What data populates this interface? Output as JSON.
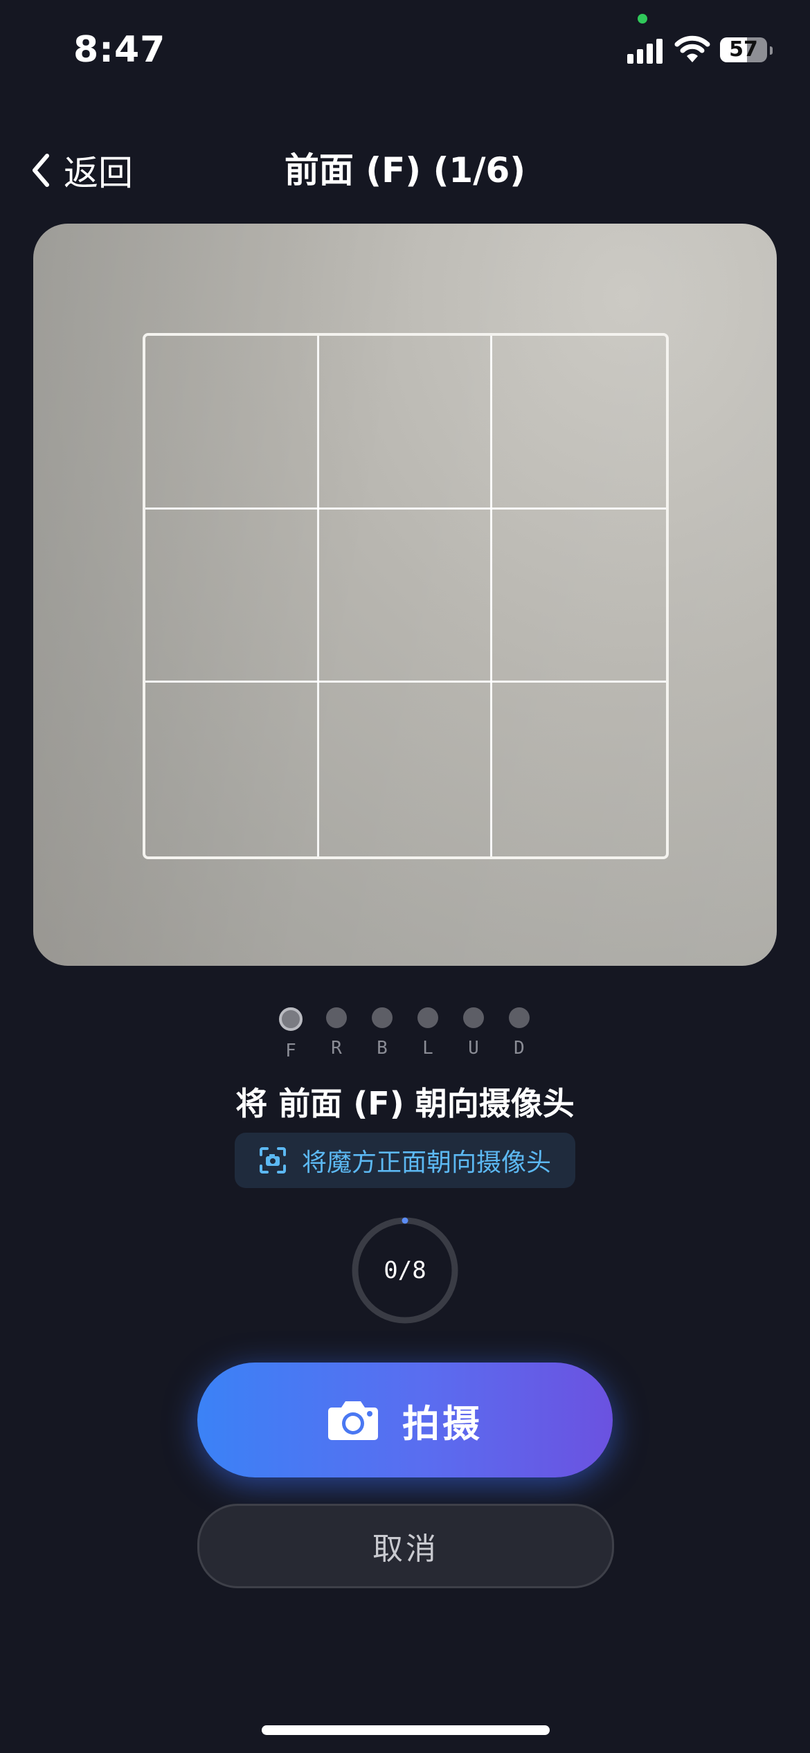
{
  "status_bar": {
    "time": "8:47",
    "battery_level": "57",
    "camera_indicator_color": "#30c85a"
  },
  "nav": {
    "back_label": "返回",
    "title": "前面 (F) (1/6)"
  },
  "scanner": {
    "grid": "3x3",
    "faces": [
      {
        "label": "F",
        "active": true
      },
      {
        "label": "R",
        "active": false
      },
      {
        "label": "B",
        "active": false
      },
      {
        "label": "L",
        "active": false
      },
      {
        "label": "U",
        "active": false
      },
      {
        "label": "D",
        "active": false
      }
    ]
  },
  "instruction": "将 前面 (F) 朝向摄像头",
  "hint": {
    "icon": "scan-camera-icon",
    "text": "将魔方正面朝向摄像头"
  },
  "progress": {
    "text": "0/8",
    "fraction": 0
  },
  "actions": {
    "shoot_label": "拍摄",
    "cancel_label": "取消"
  },
  "colors": {
    "background": "#151722",
    "accent_start": "#3b82f6",
    "accent_end": "#6b52e0",
    "hint_text": "#5cb8f2"
  }
}
